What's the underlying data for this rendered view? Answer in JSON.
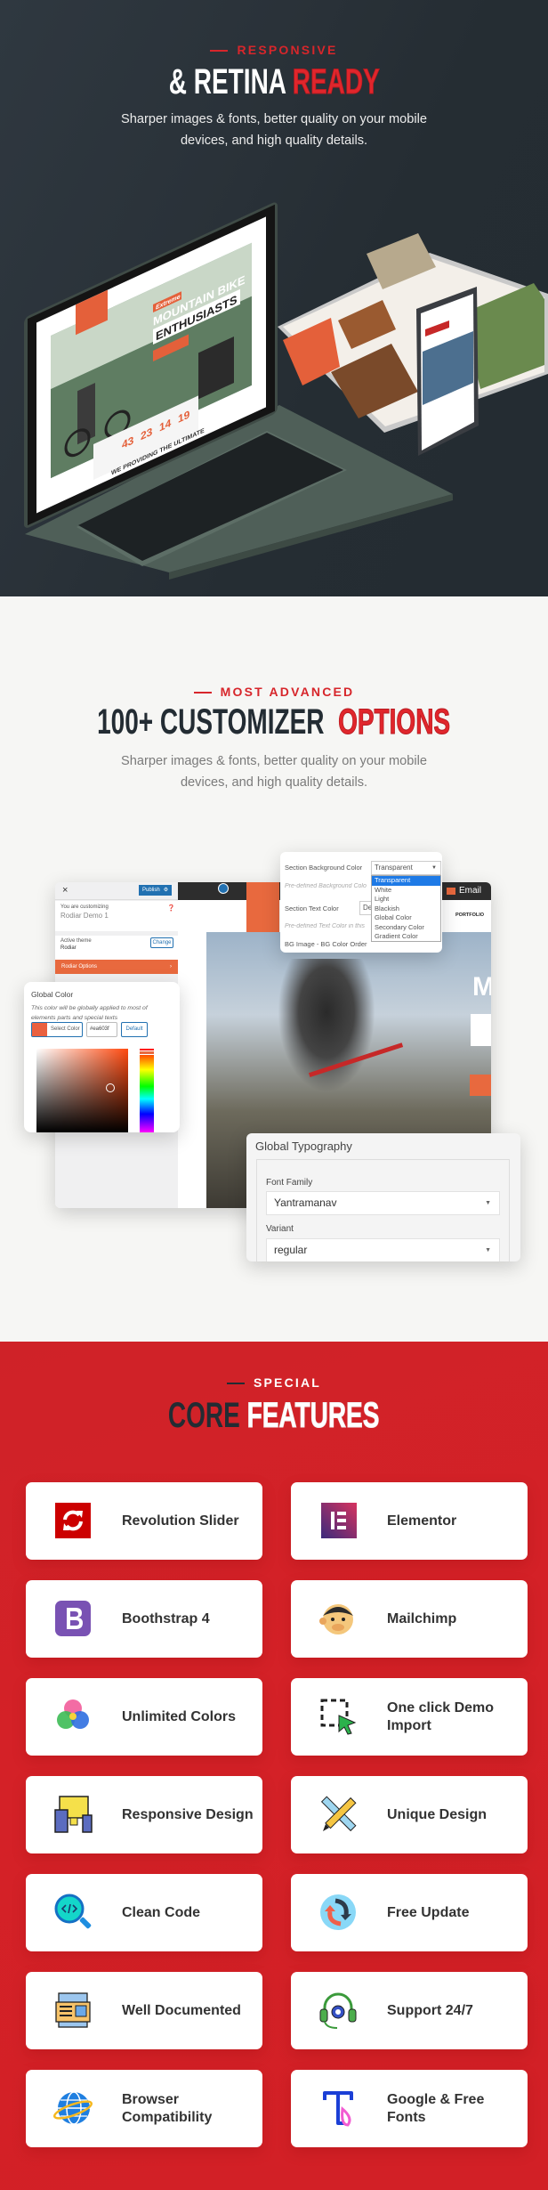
{
  "colors": {
    "dark_bg": "#252d33",
    "light_bg": "#f6f6f4",
    "red_bg": "#d42127",
    "accent": "#d7262b",
    "orange": "#e8693e",
    "wp_blue": "#2271b1"
  },
  "responsive": {
    "eyebrow": "RESPONSIVE",
    "title_solid": "& RETINA",
    "title_outline": "READY",
    "subtitle": "Sharper images & fonts, better quality on your mobile devices, and high quality details.",
    "laptop_screen": {
      "tag": "Extreme",
      "headline1": "MOUNTAIN BIKE",
      "headline2": "ENTHUSIASTS",
      "countdown": [
        "43",
        "23",
        "14",
        "19"
      ],
      "tagline": "WE PROVIDING THE ULTIMATE"
    }
  },
  "customizer": {
    "eyebrow": "MOST ADVANCED",
    "title_solid": "100+ CUSTOMIZER",
    "title_outline": "OPTIONS",
    "subtitle": "Sharper images & fonts, better quality on your mobile devices, and high quality details.",
    "sidebar": {
      "close": "×",
      "publish": "Publish",
      "customizing_label": "You are customizing",
      "site_name": "Rodiar Demo 1",
      "active_theme_label": "Active theme",
      "theme_name": "Rodiar",
      "change": "Change",
      "options_item": "Rodiar Options"
    },
    "site_nav": {
      "portfolio": "PORTFOLIO",
      "email": "Email"
    },
    "section_settings": {
      "bg_color_label": "Section Background Color",
      "bg_color_value": "Transparent",
      "bg_options": [
        "Transparent",
        "White",
        "Light",
        "Blackish",
        "Global Color",
        "Secondary Color",
        "Gradient Color"
      ],
      "bg_hint": "Pre-defined Background Colo",
      "text_color_label": "Section Text Color",
      "text_color_value": "De",
      "text_hint": "Pre-defined Text Color in this",
      "bg_order_label": "BG Image - BG Color Order"
    },
    "global_color": {
      "title": "Global Color",
      "description": "This color will be globally applied to most of elements parts and special texts",
      "select_label": "Select Color",
      "hex": "#ea603f",
      "default_label": "Default",
      "swatch": "#ea603f"
    },
    "typography": {
      "title": "Global Typography",
      "font_family_label": "Font Family",
      "font_family": "Yantramanav",
      "variant_label": "Variant",
      "variant": "regular"
    }
  },
  "features": {
    "eyebrow": "SPECIAL",
    "title_solid": "CORE",
    "title_outline": "FEATURES",
    "items": [
      {
        "label": "Revolution Slider",
        "icon": "revolution-slider-icon"
      },
      {
        "label": "Elementor",
        "icon": "elementor-icon"
      },
      {
        "label": "Boothstrap 4",
        "icon": "bootstrap-icon"
      },
      {
        "label": "Mailchimp",
        "icon": "mailchimp-icon"
      },
      {
        "label": "Unlimited Colors",
        "icon": "colors-icon"
      },
      {
        "label": "One click Demo Import",
        "icon": "demo-import-icon"
      },
      {
        "label": "Responsive Design",
        "icon": "responsive-devices-icon"
      },
      {
        "label": "Unique Design",
        "icon": "pencil-ruler-icon"
      },
      {
        "label": "Clean Code",
        "icon": "code-magnifier-icon"
      },
      {
        "label": "Free Update",
        "icon": "update-arrows-icon"
      },
      {
        "label": "Well Documented",
        "icon": "documentation-icon"
      },
      {
        "label": "Support 24/7",
        "icon": "headset-support-icon"
      },
      {
        "label": "Browser Compatibility",
        "icon": "globe-icon"
      },
      {
        "label": "Google & Free Fonts",
        "icon": "font-icon"
      }
    ]
  }
}
